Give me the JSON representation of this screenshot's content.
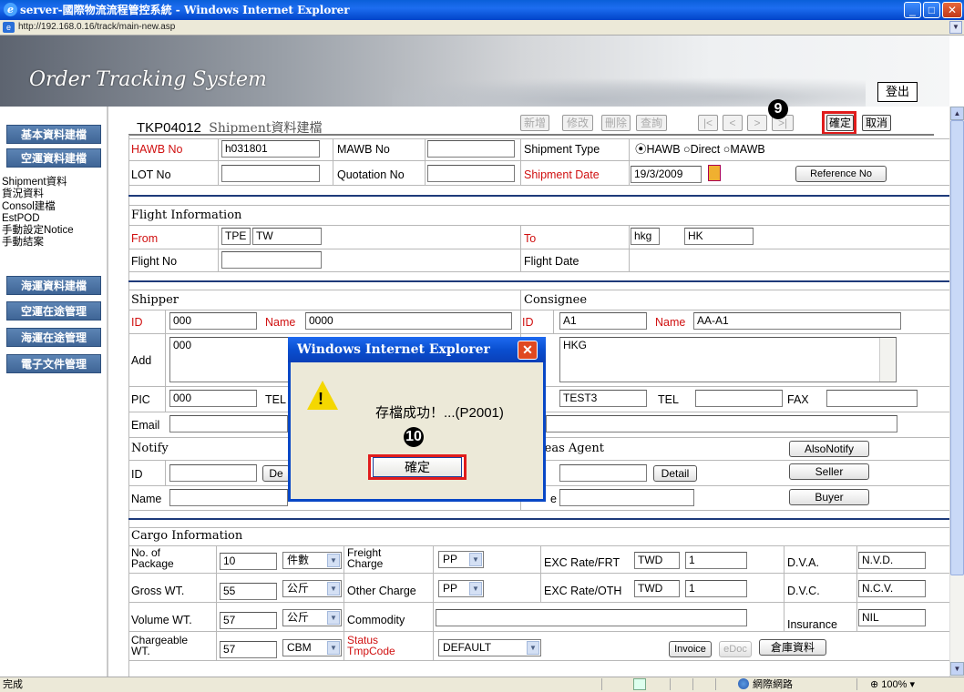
{
  "window": {
    "title": "server-國際物流流程管控系統 - Windows Internet Explorer",
    "address": "http://192.168.0.16/track/main-new.asp"
  },
  "banner": {
    "title": "Order Tracking System",
    "logout": "登出"
  },
  "sidebar": {
    "basic": "基本資料建檔",
    "air": "空運資料建檔",
    "links": [
      "Shipment資料",
      "貨況資料",
      "Consol建檔",
      "EstPOD",
      "手動設定Notice",
      "手動結案"
    ],
    "sea": "海運資料建檔",
    "air_transit": "空運在途管理",
    "sea_transit": "海運在途管理",
    "edoc": "電子文件管理"
  },
  "header": {
    "code": "TKP04012_",
    "name": "Shipment資料建檔"
  },
  "toolbar": {
    "add": "新增",
    "edit": "修改",
    "delete": "刪除",
    "query": "查詢",
    "first": "|<",
    "prev": "<",
    "next": ">",
    "last": ">|",
    "confirm": "確定",
    "cancel": "取消"
  },
  "steps": {
    "s9": "9",
    "s10": "10"
  },
  "form": {
    "hawb_label": "HAWB No",
    "hawb": "h031801",
    "mawb_label": "MAWB No",
    "mawb": "",
    "ship_type_label": "Shipment Type",
    "ship_types": [
      "HAWB",
      "Direct",
      "MAWB"
    ],
    "lot_label": "LOT No",
    "lot": "",
    "quote_label": "Quotation No",
    "quote": "",
    "ship_date_label": "Shipment Date",
    "ship_date": "19/3/2009",
    "ref_btn": "Reference No"
  },
  "flight": {
    "title": "Flight Information",
    "from_label": "From",
    "from_code": "TPE",
    "from_country": "TW",
    "to_label": "To",
    "to_code": "hkg",
    "to_country": "HK",
    "no_label": "Flight No",
    "date_label": "Flight Date"
  },
  "shipper": {
    "title": "Shipper",
    "id_label": "ID",
    "id": "000",
    "name_label": "Name",
    "name": "0000",
    "add_label": "Add",
    "add": "000",
    "pic_label": "PIC",
    "pic": "000",
    "tel_label": "TEL",
    "email_label": "Email"
  },
  "consignee": {
    "title": "Consignee",
    "id_label": "ID",
    "id": "A1",
    "name_label": "Name",
    "name": "AA-A1",
    "add": "HKG",
    "pic": "TEST3",
    "tel_label": "TEL",
    "fax_label": "FAX"
  },
  "notify": {
    "title": "Notify",
    "id_label": "ID",
    "detail": "De",
    "name_label": "Name"
  },
  "agent": {
    "title": "seas Agent",
    "detail": "Detail",
    "name_label": "e",
    "also": "AlsoNotify",
    "seller": "Seller",
    "buyer": "Buyer"
  },
  "cargo": {
    "title": "Cargo Information",
    "pkg_label": "No. of Package",
    "pkg": "10",
    "pkg_unit": "件數",
    "freight_label": "Freight Charge",
    "freight": "PP",
    "exc_frt_label": "EXC Rate/FRT",
    "exc_frt_cur": "TWD",
    "exc_frt": "1",
    "dva_label": "D.V.A.",
    "dva": "N.V.D.",
    "gross_label": "Gross WT.",
    "gross": "55",
    "gross_unit": "公斤",
    "other_label": "Other Charge",
    "other": "PP",
    "exc_oth_label": "EXC Rate/OTH",
    "exc_oth_cur": "TWD",
    "exc_oth": "1",
    "dvc_label": "D.V.C.",
    "dvc": "N.C.V.",
    "vol_label": "Volume WT.",
    "vol": "57",
    "vol_unit": "公斤",
    "commodity_label": "Commodity",
    "insurance_label": "Insurance",
    "insurance": "NIL",
    "charge_label": "Chargeable WT.",
    "charge": "57",
    "charge_unit": "CBM",
    "status_label": "Status TmpCode",
    "status": "DEFAULT",
    "invoice": "Invoice",
    "edoc": "eDoc",
    "warehouse": "倉庫資料"
  },
  "dialog": {
    "title": "Windows Internet Explorer",
    "message": "存檔成功！...(P2001)",
    "ok": "確定"
  },
  "statusbar": {
    "text": "完成",
    "zone": "網際網路",
    "zoom": "100%"
  }
}
